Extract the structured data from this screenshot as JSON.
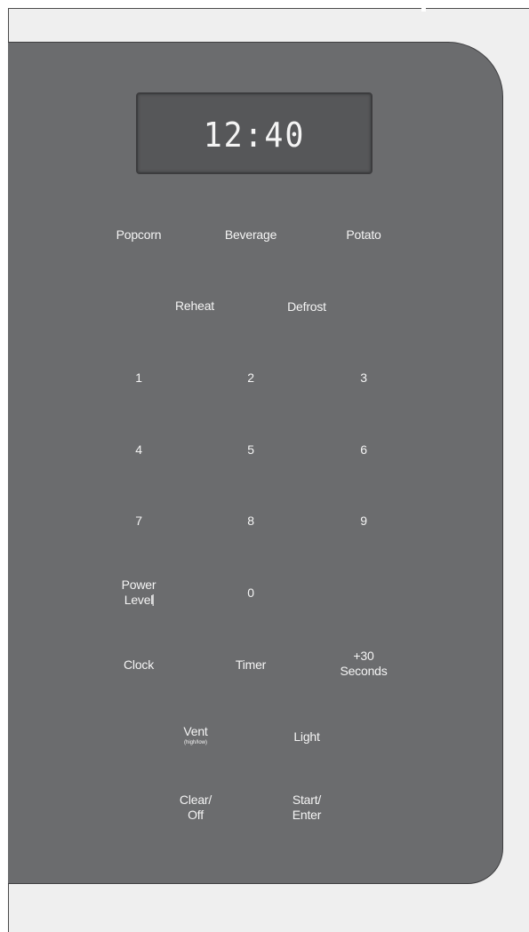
{
  "display": {
    "time": "12:40"
  },
  "keys": {
    "popcorn": "Popcorn",
    "beverage": "Beverage",
    "potato": "Potato",
    "reheat": "Reheat",
    "defrost": "Defrost",
    "num1": "1",
    "num2": "2",
    "num3": "3",
    "num4": "4",
    "num5": "5",
    "num6": "6",
    "num7": "7",
    "num8": "8",
    "num9": "9",
    "power_level_line1": "Power",
    "power_level_line2": "Level",
    "num0": "0",
    "clock": "Clock",
    "timer": "Timer",
    "plus30_line1": "+30",
    "plus30_line2": "Seconds",
    "vent": "Vent",
    "vent_sub": "(high/low)",
    "light": "Light",
    "clear_line1": "Clear/",
    "clear_line2": "Off",
    "start_line1": "Start/",
    "start_line2": "Enter"
  },
  "colors": {
    "panel": "#6b6c6e",
    "display": "#565759",
    "text": "#f4f4f4",
    "frame": "#efefef"
  }
}
